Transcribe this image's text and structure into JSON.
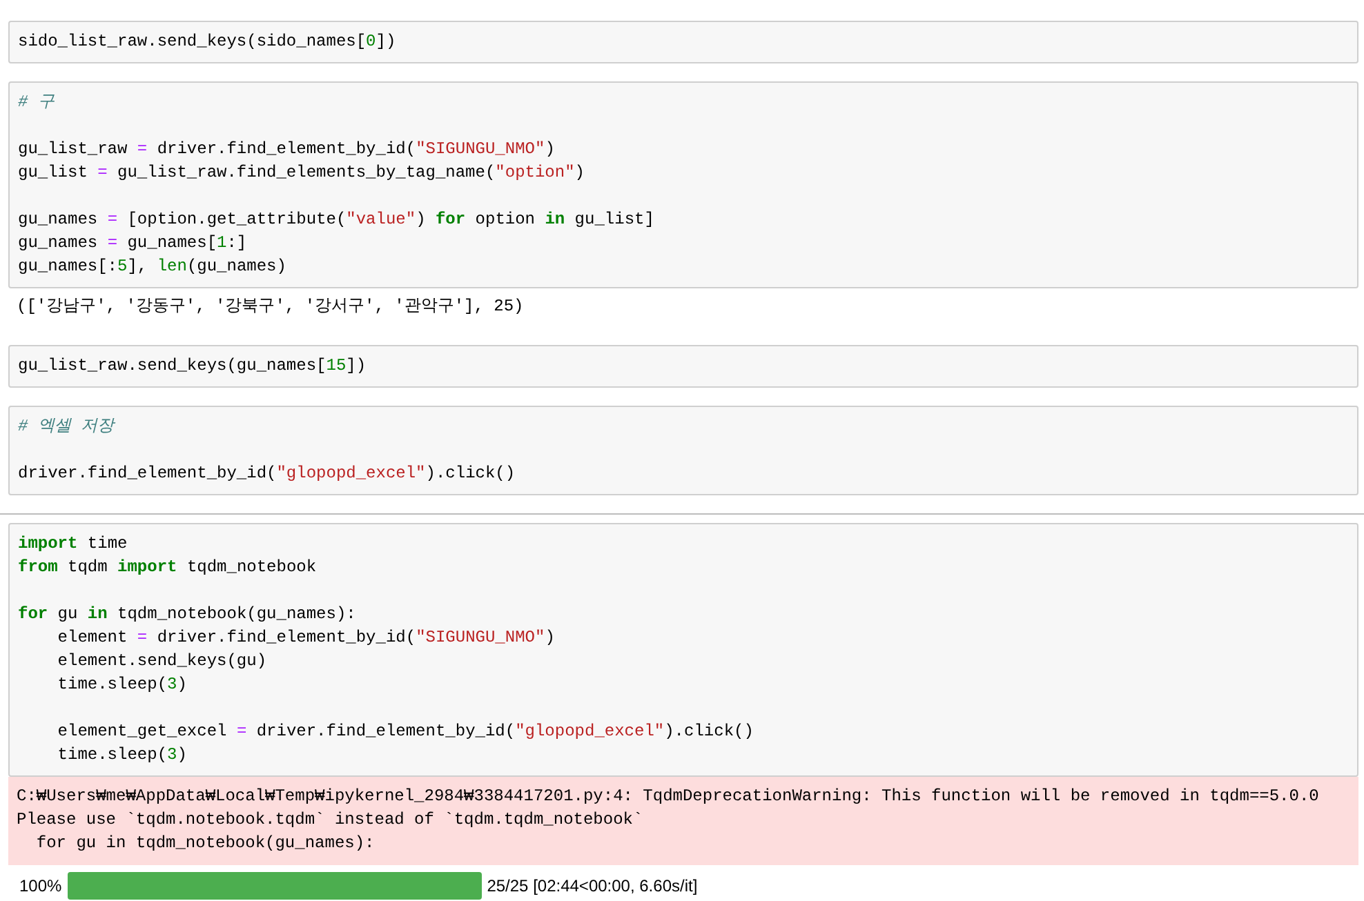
{
  "cells": [
    {
      "input": {
        "blocks": [
          [
            [
              {
                "text": "sido_list_raw.send_keys(sido_names[",
                "kind": "plain"
              },
              {
                "text": "0",
                "kind": "num"
              },
              {
                "text": "])",
                "kind": "plain"
              }
            ]
          ]
        ]
      }
    },
    {
      "input": {
        "blocks": [
          [
            [
              {
                "text": "# 구",
                "kind": "comment"
              }
            ]
          ],
          [
            [
              {
                "text": "gu_list_raw ",
                "kind": "plain"
              },
              {
                "text": "=",
                "kind": "op"
              },
              {
                "text": " driver.find_element_by_id(",
                "kind": "plain"
              },
              {
                "text": "\"SIGUNGU_NMO\"",
                "kind": "str"
              },
              {
                "text": ")",
                "kind": "plain"
              }
            ],
            [
              {
                "text": "gu_list ",
                "kind": "plain"
              },
              {
                "text": "=",
                "kind": "op"
              },
              {
                "text": " gu_list_raw.find_elements_by_tag_name(",
                "kind": "plain"
              },
              {
                "text": "\"option\"",
                "kind": "str"
              },
              {
                "text": ")",
                "kind": "plain"
              }
            ]
          ],
          [
            [
              {
                "text": "gu_names ",
                "kind": "plain"
              },
              {
                "text": "=",
                "kind": "op"
              },
              {
                "text": " [option.get_attribute(",
                "kind": "plain"
              },
              {
                "text": "\"value\"",
                "kind": "str"
              },
              {
                "text": ") ",
                "kind": "plain"
              },
              {
                "text": "for",
                "kind": "kw"
              },
              {
                "text": " option ",
                "kind": "plain"
              },
              {
                "text": "in",
                "kind": "kw"
              },
              {
                "text": " gu_list]",
                "kind": "plain"
              }
            ],
            [
              {
                "text": "gu_names ",
                "kind": "plain"
              },
              {
                "text": "=",
                "kind": "op"
              },
              {
                "text": " gu_names[",
                "kind": "plain"
              },
              {
                "text": "1",
                "kind": "num"
              },
              {
                "text": ":]",
                "kind": "plain"
              }
            ],
            [
              {
                "text": "gu_names[:",
                "kind": "plain"
              },
              {
                "text": "5",
                "kind": "num"
              },
              {
                "text": "], ",
                "kind": "plain"
              },
              {
                "text": "len",
                "kind": "builtin"
              },
              {
                "text": "(gu_names)",
                "kind": "plain"
              }
            ]
          ]
        ]
      },
      "outputs": [
        {
          "kind": "text",
          "lines": [
            "(['강남구', '강동구', '강북구', '강서구', '관악구'], 25)"
          ]
        }
      ]
    },
    {
      "input": {
        "blocks": [
          [
            [
              {
                "text": "gu_list_raw.send_keys(gu_names[",
                "kind": "plain"
              },
              {
                "text": "15",
                "kind": "num"
              },
              {
                "text": "])",
                "kind": "plain"
              }
            ]
          ]
        ]
      }
    },
    {
      "input": {
        "blocks": [
          [
            [
              {
                "text": "# 엑셀 저장",
                "kind": "comment"
              }
            ]
          ],
          [
            [
              {
                "text": "driver.find_element_by_id(",
                "kind": "plain"
              },
              {
                "text": "\"glopopd_excel\"",
                "kind": "str"
              },
              {
                "text": ").click()",
                "kind": "plain"
              }
            ]
          ]
        ]
      }
    },
    {
      "input": {
        "blocks": [
          [
            [
              {
                "text": "import",
                "kind": "kw"
              },
              {
                "text": " time",
                "kind": "plain"
              }
            ],
            [
              {
                "text": "from",
                "kind": "kw"
              },
              {
                "text": " tqdm ",
                "kind": "plain"
              },
              {
                "text": "import",
                "kind": "kw"
              },
              {
                "text": " tqdm_notebook",
                "kind": "plain"
              }
            ]
          ],
          [
            [
              {
                "text": "for",
                "kind": "kw"
              },
              {
                "text": " gu ",
                "kind": "plain"
              },
              {
                "text": "in",
                "kind": "kw"
              },
              {
                "text": " tqdm_notebook(gu_names):",
                "kind": "plain"
              }
            ],
            [
              {
                "text": "    element ",
                "kind": "plain"
              },
              {
                "text": "=",
                "kind": "op"
              },
              {
                "text": " driver.find_element_by_id(",
                "kind": "plain"
              },
              {
                "text": "\"SIGUNGU_NMO\"",
                "kind": "str"
              },
              {
                "text": ")",
                "kind": "plain"
              }
            ],
            [
              {
                "text": "    element.send_keys(gu)",
                "kind": "plain"
              }
            ],
            [
              {
                "text": "    time.sleep(",
                "kind": "plain"
              },
              {
                "text": "3",
                "kind": "num"
              },
              {
                "text": ")",
                "kind": "plain"
              }
            ]
          ],
          [
            [
              {
                "text": "    element_get_excel ",
                "kind": "plain"
              },
              {
                "text": "=",
                "kind": "op"
              },
              {
                "text": " driver.find_element_by_id(",
                "kind": "plain"
              },
              {
                "text": "\"glopopd_excel\"",
                "kind": "str"
              },
              {
                "text": ").click()",
                "kind": "plain"
              }
            ],
            [
              {
                "text": "    time.sleep(",
                "kind": "plain"
              },
              {
                "text": "3",
                "kind": "num"
              },
              {
                "text": ")",
                "kind": "plain"
              }
            ]
          ]
        ]
      },
      "outputs": [
        {
          "kind": "stderr",
          "lines": [
            "C:₩Users₩me₩AppData₩Local₩Temp₩ipykernel_2984₩3384417201.py:4: TqdmDeprecationWarning: This function will be removed in tqdm==5.0.0",
            "Please use `tqdm.notebook.tqdm` instead of `tqdm.tqdm_notebook`",
            "  for gu in tqdm_notebook(gu_names):"
          ]
        },
        {
          "kind": "progress",
          "percent": "100%",
          "level": 1,
          "status": "25/25 [02:44<00:00, 6.60s/it]"
        }
      ]
    }
  ]
}
